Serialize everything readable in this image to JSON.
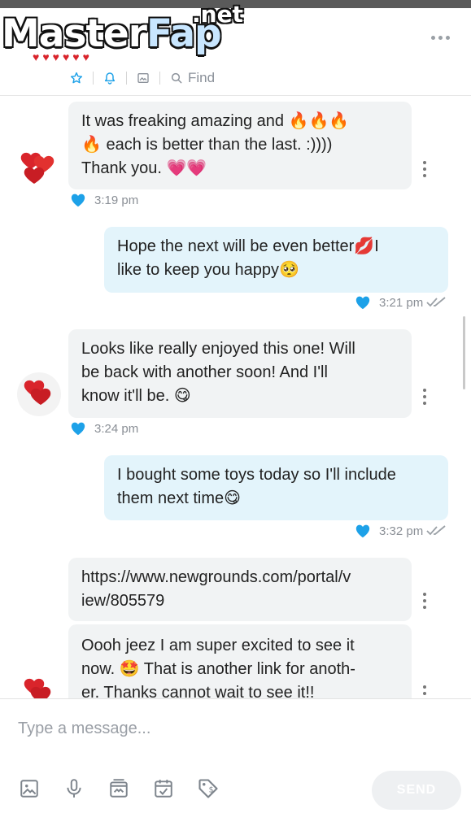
{
  "watermark": {
    "brand_main": "Master",
    "brand_accent": "Fap",
    "brand_tld": ".net"
  },
  "header": {
    "toolbar": {
      "find_label": "Find",
      "icons": [
        "star-icon",
        "bell-icon",
        "image-icon",
        "search-icon"
      ]
    }
  },
  "colors": {
    "accent_blue": "#1da1e8",
    "incoming_bubble": "#f1f3f4",
    "outgoing_bubble": "#e3f4fb",
    "heart_red": "#d9242b"
  },
  "messages": [
    {
      "direction": "incoming",
      "text": "It was freaking amazing and 🔥🔥🔥\n🔥 each is better than the last. :))))\nThank you. 💗💗",
      "time": "3:19 pm",
      "liked": true
    },
    {
      "direction": "outgoing",
      "text": "Hope the next will be even better💋I\nlike to keep you happy🥺",
      "time": "3:21 pm",
      "liked": true,
      "read": true
    },
    {
      "direction": "incoming",
      "text": "Looks like really enjoyed this one! Will\nbe back with another soon! And I'll\nknow it'll be. 😋",
      "time": "3:24 pm",
      "liked": true
    },
    {
      "direction": "outgoing",
      "text": "I bought some toys today so I'll include\nthem next time😋",
      "time": "3:32 pm",
      "liked": true,
      "read": true
    },
    {
      "direction": "incoming",
      "text": "https://www.newgrounds.com/portal/v\niew/805579"
    },
    {
      "direction": "incoming",
      "text": "Oooh jeez I am super excited to see it\nnow. 🤩 That is another link for anoth-\ner. Thanks cannot wait to see it!!"
    }
  ],
  "composer": {
    "placeholder": "Type a message...",
    "send_label": "SEND",
    "tools": [
      "image-icon",
      "microphone-icon",
      "media-vault-icon",
      "schedule-icon",
      "price-tag-icon"
    ]
  }
}
